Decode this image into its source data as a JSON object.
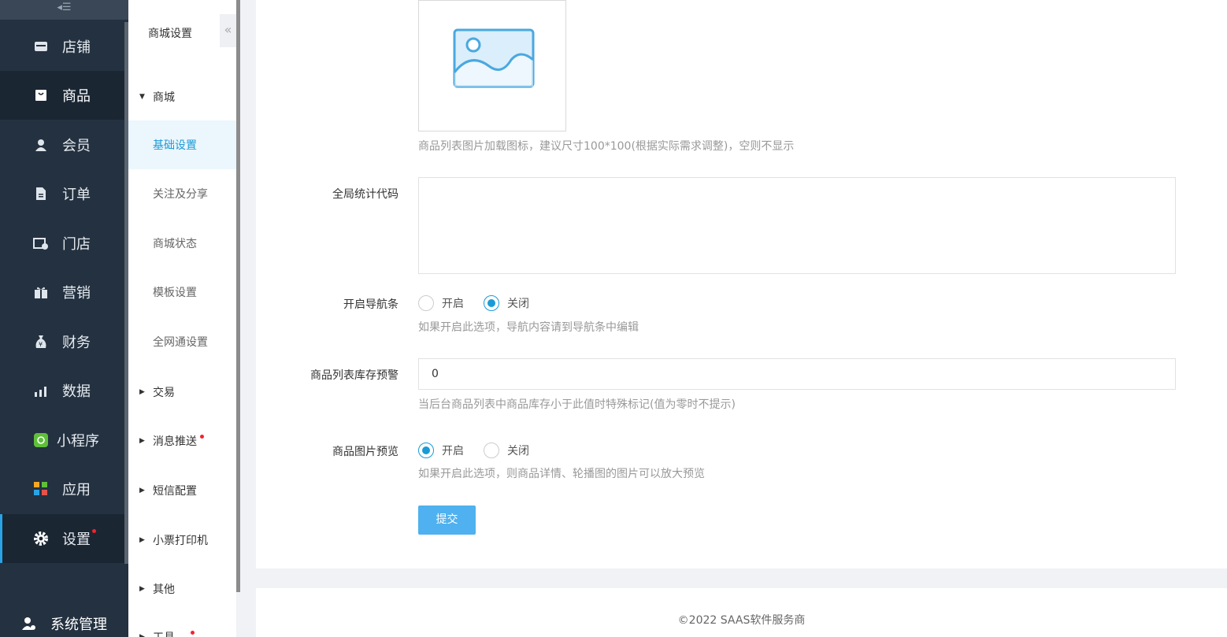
{
  "nav": {
    "collapse_icon": "collapse-menu-icon",
    "items": [
      {
        "label": "店铺",
        "icon": "store-icon"
      },
      {
        "label": "商品",
        "icon": "shopping-bag-icon"
      },
      {
        "label": "会员",
        "icon": "user-icon"
      },
      {
        "label": "订单",
        "icon": "document-icon"
      },
      {
        "label": "门店",
        "icon": "shop-settings-icon"
      },
      {
        "label": "营销",
        "icon": "gift-icon"
      },
      {
        "label": "财务",
        "icon": "money-bag-icon"
      },
      {
        "label": "数据",
        "icon": "bar-chart-icon"
      },
      {
        "label": "小程序",
        "icon": "mini-program-icon"
      },
      {
        "label": "应用",
        "icon": "apps-icon"
      },
      {
        "label": "设置",
        "icon": "gear-icon"
      }
    ],
    "system": "系统管理"
  },
  "subnav": {
    "title": "商城设置",
    "collapse": "«",
    "group_mall": "商城",
    "items": [
      "基础设置",
      "关注及分享",
      "商城状态",
      "模板设置",
      "全网通设置"
    ],
    "groups": [
      "交易",
      "消息推送",
      "短信配置",
      "小票打印机",
      "其他",
      "工具"
    ]
  },
  "form": {
    "image_hint": "商品列表图片加载图标，建议尺寸100*100(根据实际需求调整)，空则不显示",
    "stat_code_label": "全局统计代码",
    "navbar_label": "开启导航条",
    "navbar_on": "开启",
    "navbar_off": "关闭",
    "navbar_hint": "如果开启此选项，导航内容请到导航条中编辑",
    "stock_label": "商品列表库存预警",
    "stock_value": "0",
    "stock_hint": "当后台商品列表中商品库存小于此值时特殊标记(值为零时不提示)",
    "preview_label": "商品图片预览",
    "preview_on": "开启",
    "preview_off": "关闭",
    "preview_hint": "如果开启此选项，则商品详情、轮播图的图片可以放大预览",
    "submit": "提交"
  },
  "footer": {
    "copyright": "©2022 SAAS软件服务商"
  },
  "colors": {
    "nav_bg": "#243140",
    "accent": "#1a9bd7",
    "button": "#4fb1ef"
  }
}
